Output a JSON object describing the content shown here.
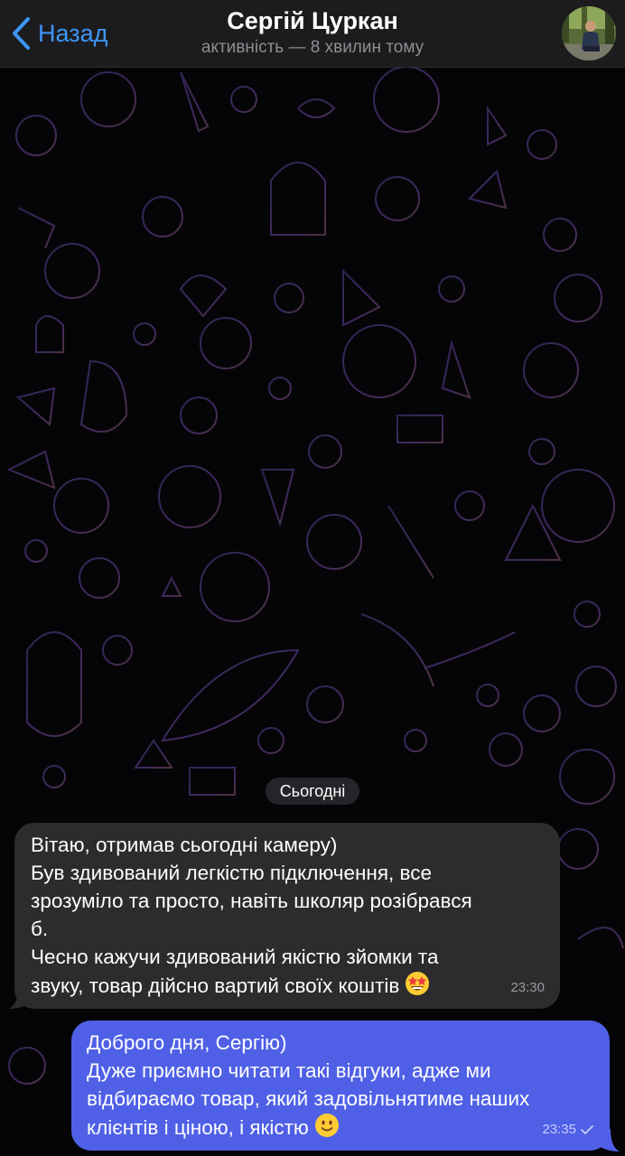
{
  "header": {
    "back_label": "Назад",
    "contact_name": "Сергій Цуркан",
    "status": "активність — 8 хвилин тому"
  },
  "chat": {
    "date_separator": "Сьогодні",
    "messages": [
      {
        "direction": "incoming",
        "lines": [
          "Вітаю, отримав сьогодні камеру)",
          "Був здивований легкістю підключення, все",
          "зрозуміло та просто, навіть школяр розібрався",
          "б.",
          "Чесно кажучи здивований якістю зйомки та",
          "звуку, товар дійсно вартий своїх коштів"
        ],
        "emoji": "star-struck-emoji",
        "time": "23:30"
      },
      {
        "direction": "outgoing",
        "lines": [
          "Доброго дня, Сергію)",
          "Дуже приємно читати такі відгуки, адже ми",
          "відбираємо товар, який задовільнятиме наших",
          "клієнтів і ціною, і якістю"
        ],
        "emoji": "slightly-smiling-emoji",
        "time": "23:35",
        "status": "sent-check"
      }
    ]
  },
  "colors": {
    "accent": "#3e96f7",
    "incoming_bubble": "#2c2c2e",
    "outgoing_bubble": "#4f60e6",
    "background": "#050507"
  }
}
